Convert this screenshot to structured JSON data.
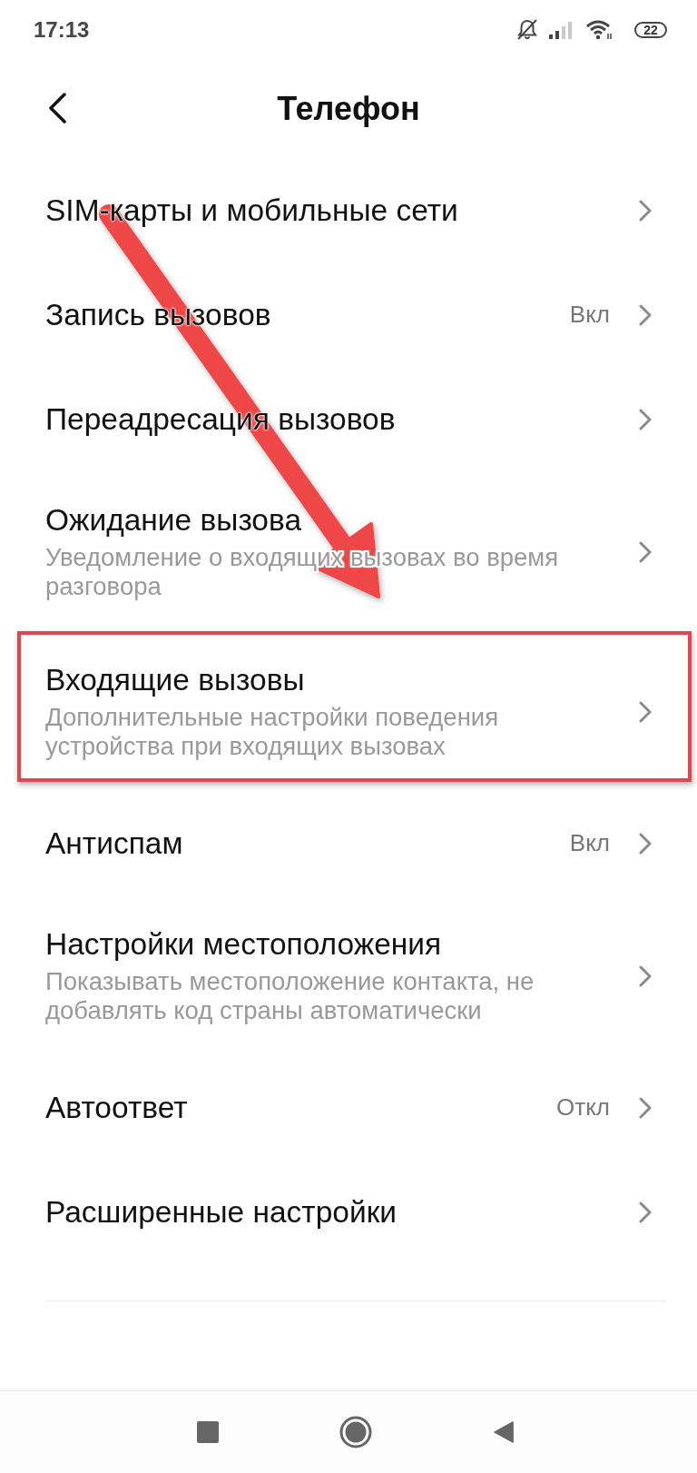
{
  "status_bar": {
    "time": "17:13",
    "battery": "22"
  },
  "header": {
    "title": "Телефон"
  },
  "settings": [
    {
      "title": "SIM-карты и мобильные сети",
      "highlighted": false
    },
    {
      "title": "Запись вызовов",
      "value": "Вкл",
      "highlighted": false
    },
    {
      "title": "Переадресация вызовов",
      "highlighted": false
    },
    {
      "title": "Ожидание вызова",
      "subtitle": "Уведомление о входящих вызовах во время разговора",
      "highlighted": false
    },
    {
      "title": "Входящие вызовы",
      "subtitle": "Дополнительные настройки поведения устройства при входящих вызовах",
      "highlighted": true
    },
    {
      "title": "Антиспам",
      "value": "Вкл",
      "highlighted": false
    },
    {
      "title": "Настройки местоположения",
      "subtitle": "Показывать местоположение контакта, не добавлять код страны автоматически",
      "highlighted": false
    },
    {
      "title": "Автоответ",
      "value": "Откл",
      "highlighted": false
    },
    {
      "title": "Расширенные настройки",
      "highlighted": false
    }
  ]
}
